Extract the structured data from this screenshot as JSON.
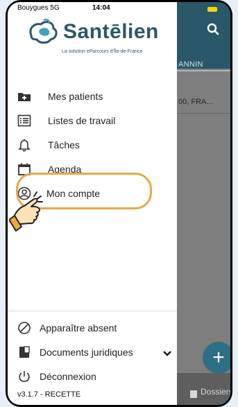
{
  "status_bar": {
    "carrier": "Bouygues 5G",
    "time": "14:04",
    "battery_color": "#f5d400"
  },
  "brand": {
    "name": "Santēlien",
    "tagline": "La solution eParcours d'Île-de-France",
    "color": "#2b5868"
  },
  "background_app": {
    "tab_text": "ANNIN",
    "row_text": "00, FRA...",
    "bottom_nav_label": "Dossiers",
    "search_icon": "search-icon",
    "fab_icon": "plus-icon"
  },
  "menu": {
    "items": [
      {
        "label": "Mes patients",
        "icon": "add-folder-icon"
      },
      {
        "label": "Listes de travail",
        "icon": "list-icon"
      },
      {
        "label": "Tâches",
        "icon": "bell-icon"
      },
      {
        "label": "Agenda",
        "icon": "calendar-icon"
      },
      {
        "label": "Mon compte",
        "icon": "user-circle-icon",
        "highlighted": true
      }
    ],
    "bottom_items": [
      {
        "label": "Apparaître absent",
        "icon": "block-icon"
      },
      {
        "label": "Documents juridiques",
        "icon": "document-icon",
        "expandable": true
      },
      {
        "label": "Déconnexion",
        "icon": "power-icon"
      }
    ],
    "version": "v3.1.7 - RECETTE"
  },
  "colors": {
    "accent": "#2b5868",
    "highlight": "#e9a84a",
    "fab": "#2f6f86"
  }
}
